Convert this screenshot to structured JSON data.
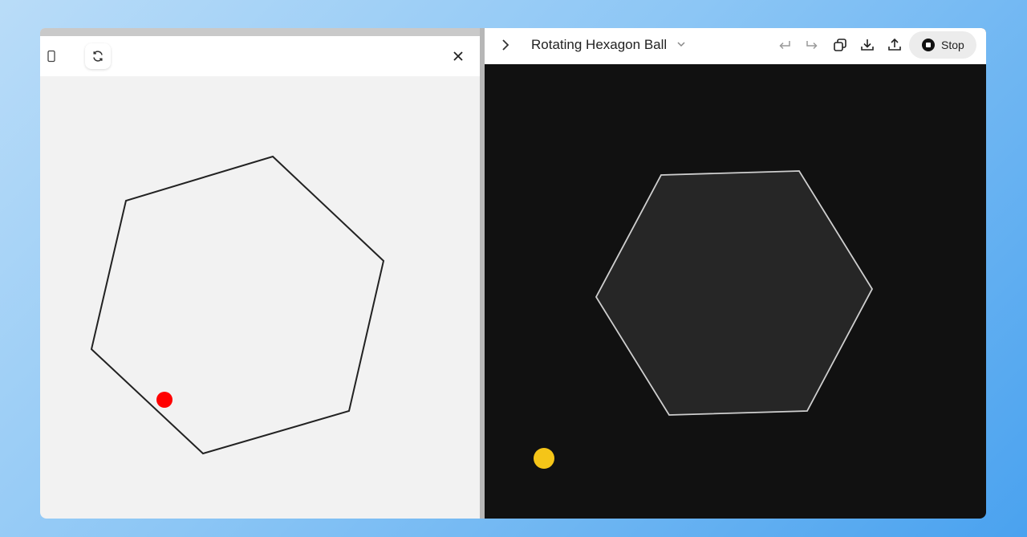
{
  "left_panel": {
    "toolbar": {
      "buttons": [
        {
          "icon": "device-frame-icon"
        },
        {
          "icon": "refresh-icon"
        },
        {
          "icon": "close-icon"
        }
      ]
    },
    "canvas": {
      "shape": "hexagon",
      "ball_color": "#ff0000",
      "line_color": "#222222",
      "background": "#f2f2f2"
    }
  },
  "right_panel": {
    "toolbar": {
      "expand_icon": "chevron-right-icon",
      "title": "Rotating Hexagon Ball",
      "dropdown_icon": "chevron-down-icon",
      "actions": [
        "undo-icon",
        "redo-icon",
        "copy-icon",
        "download-icon",
        "share-icon"
      ],
      "stop_label": "Stop"
    },
    "canvas": {
      "shape": "hexagon",
      "ball_color": "#f5c518",
      "hexagon_fill": "#262626",
      "hexagon_stroke": "#cfcfcf",
      "background": "#111111"
    }
  }
}
